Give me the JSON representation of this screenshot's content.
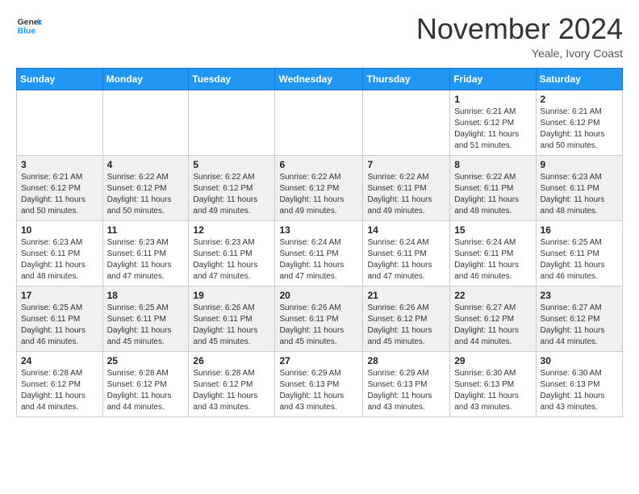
{
  "header": {
    "logo_line1": "General",
    "logo_line2": "Blue",
    "month": "November 2024",
    "location": "Yeale, Ivory Coast"
  },
  "weekdays": [
    "Sunday",
    "Monday",
    "Tuesday",
    "Wednesday",
    "Thursday",
    "Friday",
    "Saturday"
  ],
  "weeks": [
    [
      {
        "day": "",
        "info": ""
      },
      {
        "day": "",
        "info": ""
      },
      {
        "day": "",
        "info": ""
      },
      {
        "day": "",
        "info": ""
      },
      {
        "day": "",
        "info": ""
      },
      {
        "day": "1",
        "info": "Sunrise: 6:21 AM\nSunset: 6:12 PM\nDaylight: 11 hours\nand 51 minutes."
      },
      {
        "day": "2",
        "info": "Sunrise: 6:21 AM\nSunset: 6:12 PM\nDaylight: 11 hours\nand 50 minutes."
      }
    ],
    [
      {
        "day": "3",
        "info": "Sunrise: 6:21 AM\nSunset: 6:12 PM\nDaylight: 11 hours\nand 50 minutes."
      },
      {
        "day": "4",
        "info": "Sunrise: 6:22 AM\nSunset: 6:12 PM\nDaylight: 11 hours\nand 50 minutes."
      },
      {
        "day": "5",
        "info": "Sunrise: 6:22 AM\nSunset: 6:12 PM\nDaylight: 11 hours\nand 49 minutes."
      },
      {
        "day": "6",
        "info": "Sunrise: 6:22 AM\nSunset: 6:12 PM\nDaylight: 11 hours\nand 49 minutes."
      },
      {
        "day": "7",
        "info": "Sunrise: 6:22 AM\nSunset: 6:11 PM\nDaylight: 11 hours\nand 49 minutes."
      },
      {
        "day": "8",
        "info": "Sunrise: 6:22 AM\nSunset: 6:11 PM\nDaylight: 11 hours\nand 48 minutes."
      },
      {
        "day": "9",
        "info": "Sunrise: 6:23 AM\nSunset: 6:11 PM\nDaylight: 11 hours\nand 48 minutes."
      }
    ],
    [
      {
        "day": "10",
        "info": "Sunrise: 6:23 AM\nSunset: 6:11 PM\nDaylight: 11 hours\nand 48 minutes."
      },
      {
        "day": "11",
        "info": "Sunrise: 6:23 AM\nSunset: 6:11 PM\nDaylight: 11 hours\nand 47 minutes."
      },
      {
        "day": "12",
        "info": "Sunrise: 6:23 AM\nSunset: 6:11 PM\nDaylight: 11 hours\nand 47 minutes."
      },
      {
        "day": "13",
        "info": "Sunrise: 6:24 AM\nSunset: 6:11 PM\nDaylight: 11 hours\nand 47 minutes."
      },
      {
        "day": "14",
        "info": "Sunrise: 6:24 AM\nSunset: 6:11 PM\nDaylight: 11 hours\nand 47 minutes."
      },
      {
        "day": "15",
        "info": "Sunrise: 6:24 AM\nSunset: 6:11 PM\nDaylight: 11 hours\nand 46 minutes."
      },
      {
        "day": "16",
        "info": "Sunrise: 6:25 AM\nSunset: 6:11 PM\nDaylight: 11 hours\nand 46 minutes."
      }
    ],
    [
      {
        "day": "17",
        "info": "Sunrise: 6:25 AM\nSunset: 6:11 PM\nDaylight: 11 hours\nand 46 minutes."
      },
      {
        "day": "18",
        "info": "Sunrise: 6:25 AM\nSunset: 6:11 PM\nDaylight: 11 hours\nand 45 minutes."
      },
      {
        "day": "19",
        "info": "Sunrise: 6:26 AM\nSunset: 6:11 PM\nDaylight: 11 hours\nand 45 minutes."
      },
      {
        "day": "20",
        "info": "Sunrise: 6:26 AM\nSunset: 6:11 PM\nDaylight: 11 hours\nand 45 minutes."
      },
      {
        "day": "21",
        "info": "Sunrise: 6:26 AM\nSunset: 6:12 PM\nDaylight: 11 hours\nand 45 minutes."
      },
      {
        "day": "22",
        "info": "Sunrise: 6:27 AM\nSunset: 6:12 PM\nDaylight: 11 hours\nand 44 minutes."
      },
      {
        "day": "23",
        "info": "Sunrise: 6:27 AM\nSunset: 6:12 PM\nDaylight: 11 hours\nand 44 minutes."
      }
    ],
    [
      {
        "day": "24",
        "info": "Sunrise: 6:28 AM\nSunset: 6:12 PM\nDaylight: 11 hours\nand 44 minutes."
      },
      {
        "day": "25",
        "info": "Sunrise: 6:28 AM\nSunset: 6:12 PM\nDaylight: 11 hours\nand 44 minutes."
      },
      {
        "day": "26",
        "info": "Sunrise: 6:28 AM\nSunset: 6:12 PM\nDaylight: 11 hours\nand 43 minutes."
      },
      {
        "day": "27",
        "info": "Sunrise: 6:29 AM\nSunset: 6:13 PM\nDaylight: 11 hours\nand 43 minutes."
      },
      {
        "day": "28",
        "info": "Sunrise: 6:29 AM\nSunset: 6:13 PM\nDaylight: 11 hours\nand 43 minutes."
      },
      {
        "day": "29",
        "info": "Sunrise: 6:30 AM\nSunset: 6:13 PM\nDaylight: 11 hours\nand 43 minutes."
      },
      {
        "day": "30",
        "info": "Sunrise: 6:30 AM\nSunset: 6:13 PM\nDaylight: 11 hours\nand 43 minutes."
      }
    ]
  ]
}
